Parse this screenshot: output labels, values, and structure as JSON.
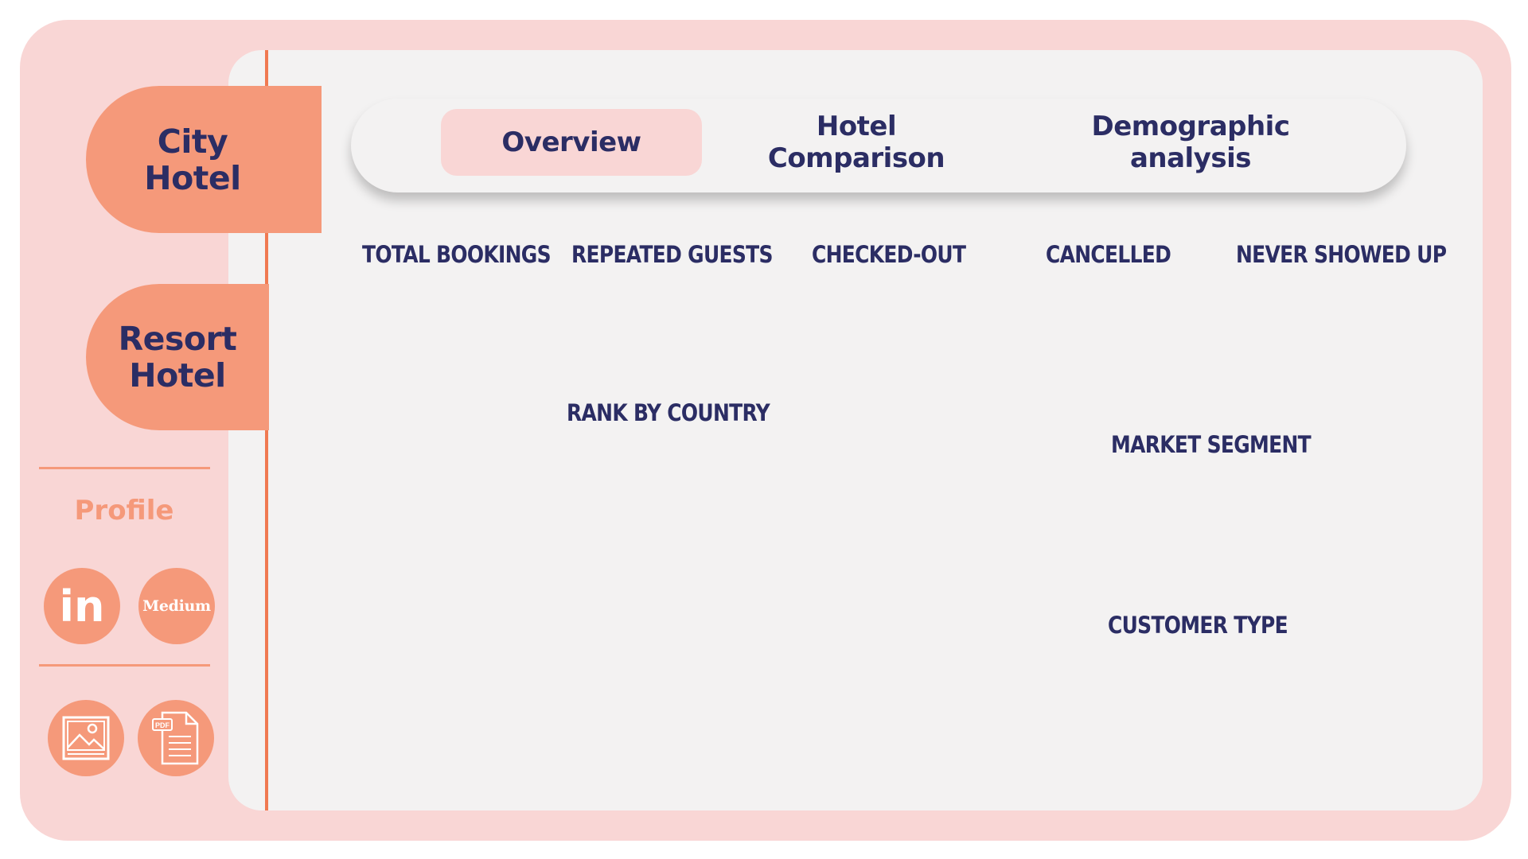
{
  "sidebar": {
    "hotels": [
      {
        "label": "City\nHotel",
        "active": true
      },
      {
        "label": "Resort\nHotel",
        "active": false
      }
    ],
    "profile_label": "Profile",
    "social": {
      "linkedin_label": "in",
      "medium_label": "Medium"
    },
    "exports": [
      {
        "icon": "image-icon"
      },
      {
        "icon": "pdf-file-icon",
        "badge": "PDF"
      }
    ]
  },
  "tabs": [
    {
      "label": "Overview",
      "active": true
    },
    {
      "label": "Hotel\nComparison",
      "active": false
    },
    {
      "label": "Demographic\nanalysis",
      "active": false
    }
  ],
  "kpis": [
    "TOTAL BOOKINGS",
    "REPEATED GUESTS",
    "CHECKED-OUT",
    "CANCELLED",
    "NEVER SHOWED UP"
  ],
  "sections": {
    "rank_by_country": "RANK BY COUNTRY",
    "market_segment": "MARKET SEGMENT",
    "customer_type": "CUSTOMER TYPE"
  },
  "colors": {
    "outer_bg": "#f9d6d5",
    "panel_bg": "#f3f2f2",
    "accent": "#f5997a",
    "accent_line": "#f07a52",
    "text_dark": "#2b2d64"
  }
}
